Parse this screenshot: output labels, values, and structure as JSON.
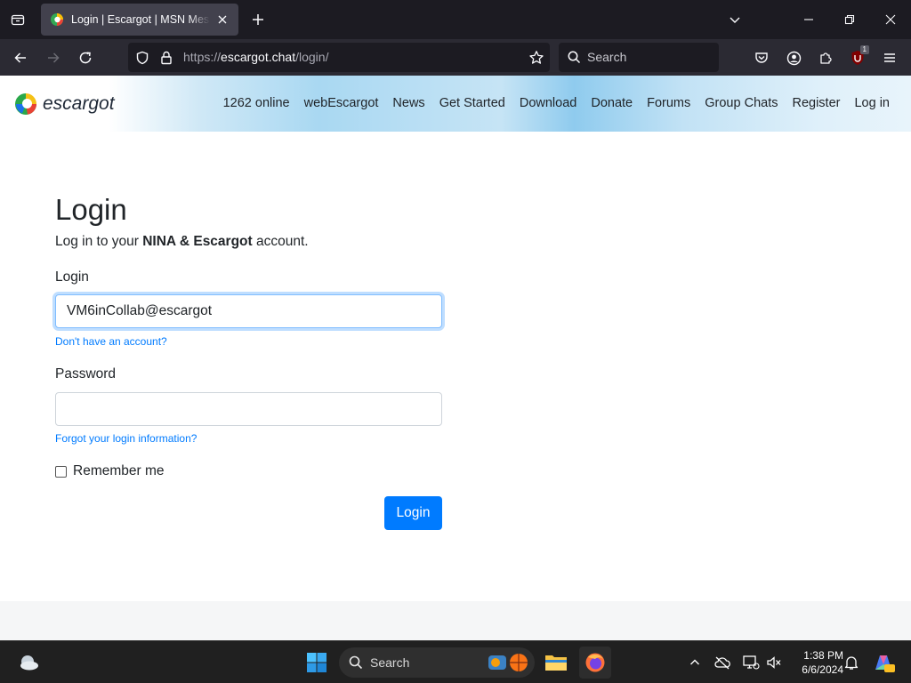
{
  "browser": {
    "tab_title": "Login | Escargot | MSN Messenger",
    "url_domain": "escargot.chat",
    "url_path": "/login/",
    "url_scheme": "https://",
    "search_placeholder": "Search",
    "extension_badge": "1"
  },
  "site": {
    "logo_text": "escargot",
    "nav": [
      "1262 online",
      "webEscargot",
      "News",
      "Get Started",
      "Download",
      "Donate",
      "Forums",
      "Group Chats",
      "Register",
      "Log in"
    ]
  },
  "login": {
    "heading": "Login",
    "subtitle_prefix": "Log in to your ",
    "subtitle_bold": "NINA & Escargot",
    "subtitle_suffix": " account.",
    "login_label": "Login",
    "login_value": "VM6inCollab@escargot",
    "no_account_link": "Don't have an account?",
    "password_label": "Password",
    "password_value": "",
    "forgot_link": "Forgot your login information?",
    "remember_label": "Remember me",
    "remember_checked": false,
    "submit_label": "Login"
  },
  "taskbar": {
    "search_label": "Search",
    "time": "1:38 PM",
    "date": "6/6/2024"
  },
  "colors": {
    "accent": "#007bff",
    "chrome_dark": "#1c1b22",
    "taskbar": "#202020"
  }
}
